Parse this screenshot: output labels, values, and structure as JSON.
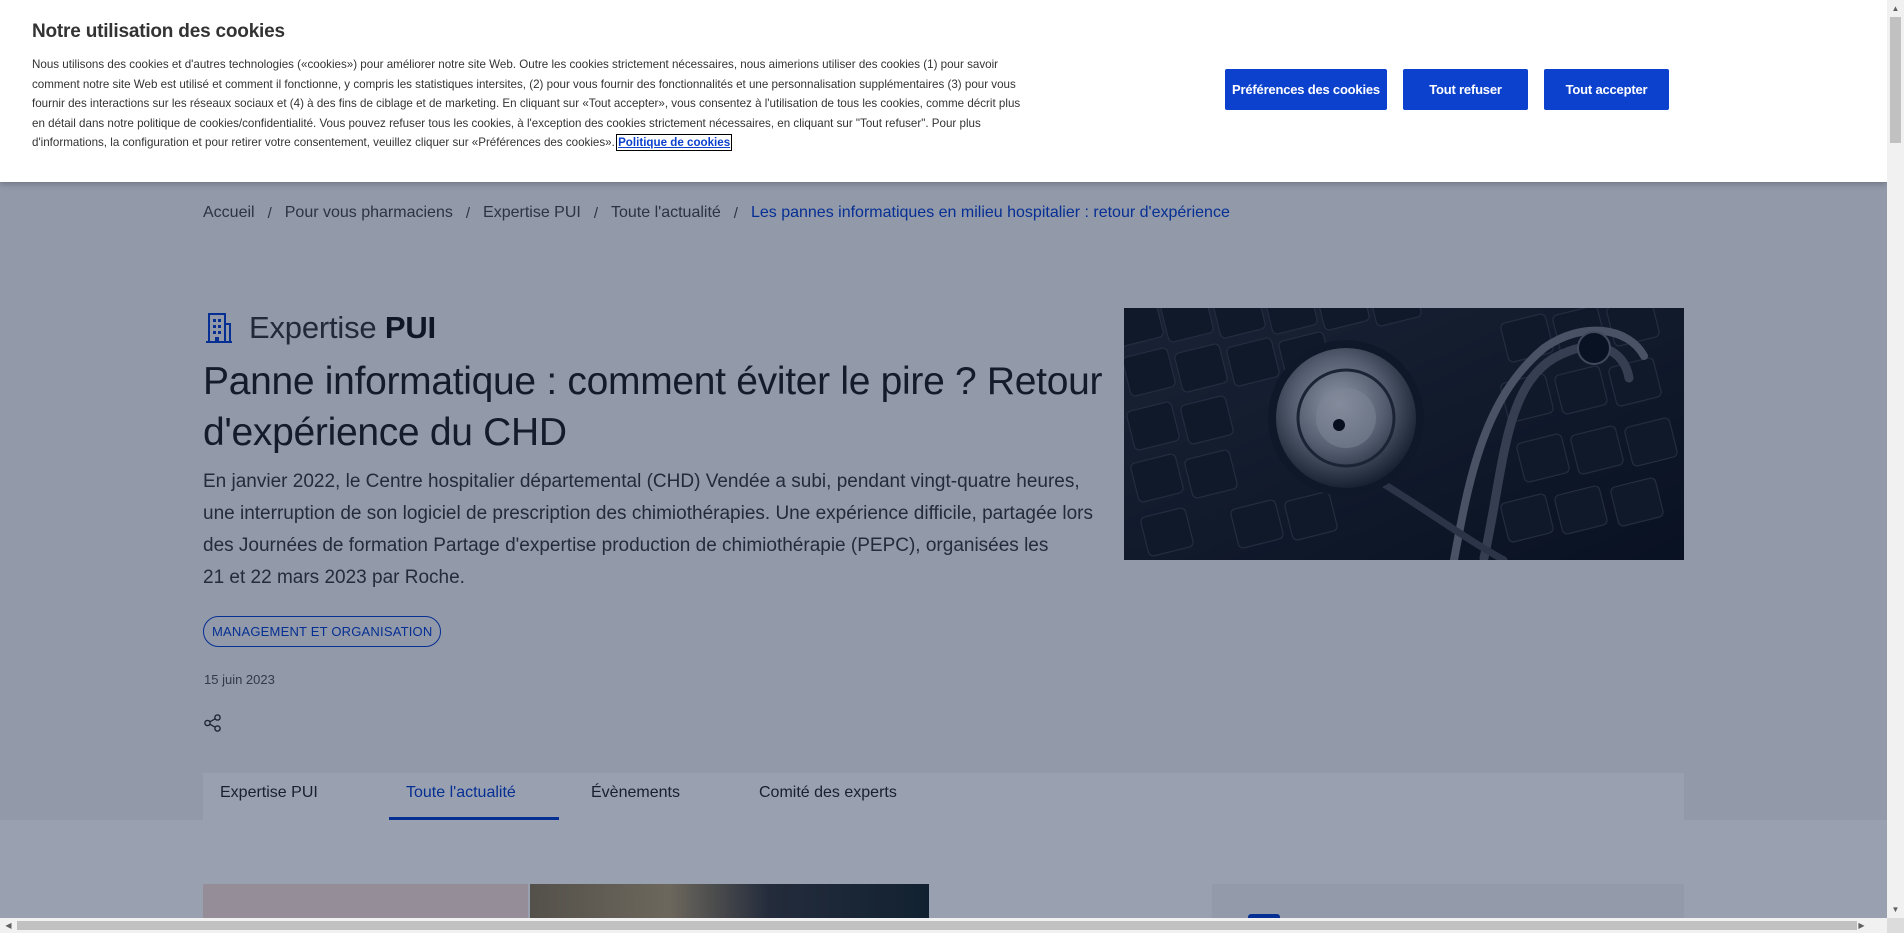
{
  "breadcrumb": {
    "items": [
      "Accueil",
      "Pour vous pharmaciens",
      "Expertise PUI",
      "Toute l'actualité"
    ],
    "current": "Les pannes informatiques en milieu hospitalier : retour d'expérience",
    "separator": "/"
  },
  "section": {
    "label_light": "Expertise ",
    "label_bold": "PUI",
    "icon": "building-icon"
  },
  "article": {
    "title": "Panne informatique : comment éviter le pire ? Retour d'expérience du CHD",
    "lead_line1": "En janvier 2022, le Centre hospitalier départemental (CHD) Vendée a subi, pendant vingt-quatre heures, une interruption de son logiciel de prescription des chimiothérapies. Une expérience difficile, partagée lors des Journées de formation Partage d'expertise production de chimiothérapie (PEPC), organisées les",
    "lead_line2": "21 et 22 mars 2023 par Roche.",
    "tag": "MANAGEMENT ET ORGANISATION",
    "date": "15 juin 2023",
    "share_icon": "share-icon",
    "image_subject": "stethoscope-on-keyboard"
  },
  "tabs": [
    {
      "label": "Expertise PUI",
      "active": false
    },
    {
      "label": "Toute l'actualité",
      "active": true
    },
    {
      "label": "Évènements",
      "active": false
    },
    {
      "label": "Comité des experts",
      "active": false
    }
  ],
  "cookie_banner": {
    "title": "Notre utilisation des cookies",
    "text": "Nous utilisons des cookies et d'autres technologies («cookies») pour améliorer notre site Web. Outre les cookies strictement nécessaires, nous aimerions utiliser des cookies (1) pour savoir comment notre site Web est utilisé et comment il fonctionne, y compris les statistiques intersites, (2) pour vous fournir des fonctionnalités et une personnalisation supplémentaires (3) pour vous fournir des interactions sur les réseaux sociaux et (4) à des fins de ciblage et de marketing. En cliquant sur «Tout accepter», vous consentez à l'utilisation de tous les cookies, comme décrit plus en détail dans notre politique de cookies/confidentialité. Vous pouvez refuser tous les cookies, à l'exception des cookies strictement nécessaires, en cliquant sur \"Tout refuser\". Pour plus d'informations, la configuration et pour retirer votre consentement, veuillez cliquer sur «Préférences des cookies».",
    "policy_link": "Politique de cookies",
    "buttons": {
      "preferences": "Préférences des cookies",
      "refuse": "Tout refuser",
      "accept": "Tout accepter"
    }
  },
  "colors": {
    "accent": "#0b41cd",
    "overlay": "rgba(0,20,60,0.40)",
    "hero_bg": "#f3f3f3",
    "tag_border": "#0b41cd"
  }
}
